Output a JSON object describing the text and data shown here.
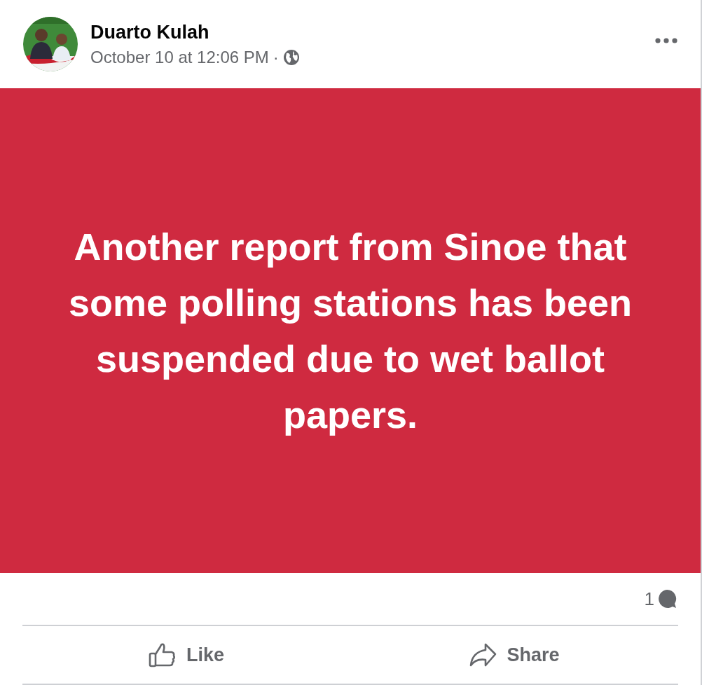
{
  "post": {
    "author": "Duarto Kulah",
    "timestamp": "October 10 at 12:06 PM",
    "separator": "·",
    "text": "Another report from Sinoe that some polling stations has been suspended due to wet ballot papers."
  },
  "stats": {
    "comments": "1"
  },
  "actions": [
    {
      "kind": "like",
      "label": "Like"
    },
    {
      "kind": "share",
      "label": "Share"
    }
  ]
}
